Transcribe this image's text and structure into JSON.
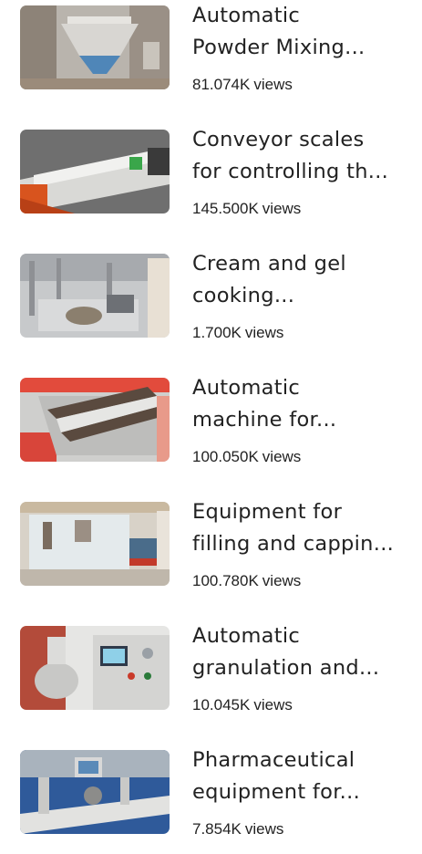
{
  "videos": [
    {
      "line1": "Automatic",
      "line2": "Powder Mixing...",
      "views": "81.074K",
      "views_unit": "views"
    },
    {
      "line1": "Conveyor scales",
      "line2": "for controlling th...",
      "views": "145.500K",
      "views_unit": "views"
    },
    {
      "line1": "Cream and gel",
      "line2": "cooking...",
      "views": "1.700K",
      "views_unit": "views"
    },
    {
      "line1": "Automatic",
      "line2": "machine for...",
      "views": "100.050K",
      "views_unit": "views"
    },
    {
      "line1": "Equipment for",
      "line2": "filling and cappin...",
      "views": "100.780K",
      "views_unit": "views"
    },
    {
      "line1": "Automatic",
      "line2": "granulation and...",
      "views": "10.045K",
      "views_unit": "views"
    },
    {
      "line1": "Pharmaceutical",
      "line2": "equipment for...",
      "views": "7.854K",
      "views_unit": "views"
    }
  ]
}
